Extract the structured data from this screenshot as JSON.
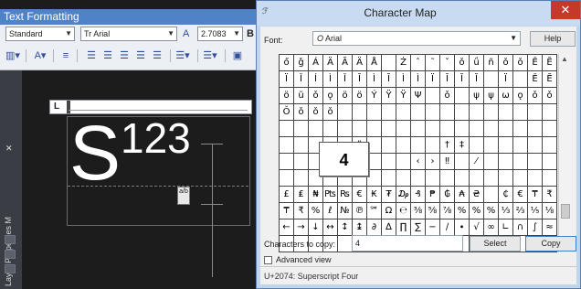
{
  "text_formatting": {
    "title": "Text Formatting",
    "style_value": "Standard",
    "font_value": "Arial",
    "font_prefix": "Tr",
    "height_value": "2.7083",
    "side_panel_label": "Layer Properties M"
  },
  "editor": {
    "main_text": "S",
    "superscript_text": "123",
    "stack_icon_text": "a/b"
  },
  "charmap": {
    "title": "Character Map",
    "font_label": "Font:",
    "font_value": "Arial",
    "font_prefix": "O",
    "help_label": "Help",
    "magnified_char": "4",
    "copy_label": "Characters to copy:",
    "copy_value": "4",
    "select_label": "Select",
    "copy_button_label": "Copy",
    "advanced_view_label": "Advanced view",
    "status_text": "U+2074: Superscript Four",
    "grid": [
      [
        "ő",
        "ǧ",
        "Á",
        "Ä",
        "Ã",
        "Ä",
        "Å",
        "",
        "Ż",
        "ˆ",
        "˜",
        "ˇ",
        "ǒ",
        "ǘ",
        "ñ",
        "ǒ",
        "ǒ",
        "Ě",
        "Ĕ"
      ],
      [
        "Ï",
        "Ǐ",
        "Í",
        "Ì",
        "Ǐ",
        "Ī",
        "Ì",
        "Ĩ",
        "Ì",
        "Ì",
        "Ï",
        "Ī",
        "Ĭ",
        "Ĭ",
        "",
        "Ï",
        "",
        "Ě",
        "Ĕ"
      ],
      [
        "ö",
        "ŭ",
        "ǒ",
        "ǫ",
        "ö",
        "ö",
        "Ý",
        "Ÿ",
        "Ÿ",
        "Ψ",
        "",
        "ǒ",
        "",
        "ψ",
        "ψ",
        "ω",
        "ǫ",
        "ǒ",
        "ǒ"
      ],
      [
        "Ǒ",
        "ǒ",
        "ǒ",
        "ǒ",
        "",
        "",
        "",
        "",
        "",
        "",
        "",
        "",
        "",
        "",
        "",
        "",
        "",
        "",
        ""
      ],
      [
        "",
        "",
        "",
        "",
        "",
        "",
        "",
        "",
        "",
        "",
        "",
        "",
        "",
        "",
        "",
        "",
        "",
        "",
        ""
      ],
      [
        "",
        "",
        "",
        "",
        "",
        "‖",
        "",
        "",
        "",
        "",
        "",
        "†",
        "‡",
        "",
        "",
        "",
        "",
        "",
        ""
      ],
      [
        "",
        "",
        "",
        "",
        "",
        "‰",
        "",
        "",
        "",
        "‹",
        "›",
        "‼",
        "",
        "⁄",
        "",
        "",
        "",
        "",
        ""
      ],
      [
        "",
        "",
        "",
        "",
        "",
        "",
        "",
        "",
        "",
        "",
        "",
        "",
        "",
        "",
        "",
        "",
        "",
        "",
        ""
      ],
      [
        "£",
        "₤",
        "₦",
        "₧",
        "₨",
        "€",
        "₭",
        "₮",
        "₯",
        "₰",
        "₱",
        "₲",
        "₳",
        "₴",
        "",
        "₵",
        "€",
        "₸",
        "₹"
      ],
      [
        "₸",
        "₹",
        "%",
        "ℓ",
        "№",
        "℗",
        "℠",
        "Ω",
        "℮",
        "⅜",
        "⅝",
        "⅞",
        "%",
        "%",
        "%",
        "⅓",
        "⅔",
        "⅕",
        "⅛"
      ],
      [
        "←",
        "→",
        "↓",
        "↔",
        "↕",
        "↨",
        "∂",
        "∆",
        "∏",
        "∑",
        "−",
        "∕",
        "∙",
        "√",
        "∞",
        "∟",
        "∩",
        "∫",
        "≈"
      ],
      [
        "",
        "",
        "",
        "",
        "",
        "",
        "",
        "",
        "",
        "",
        "",
        "",
        "",
        "",
        "",
        "",
        "",
        "",
        ""
      ]
    ]
  }
}
